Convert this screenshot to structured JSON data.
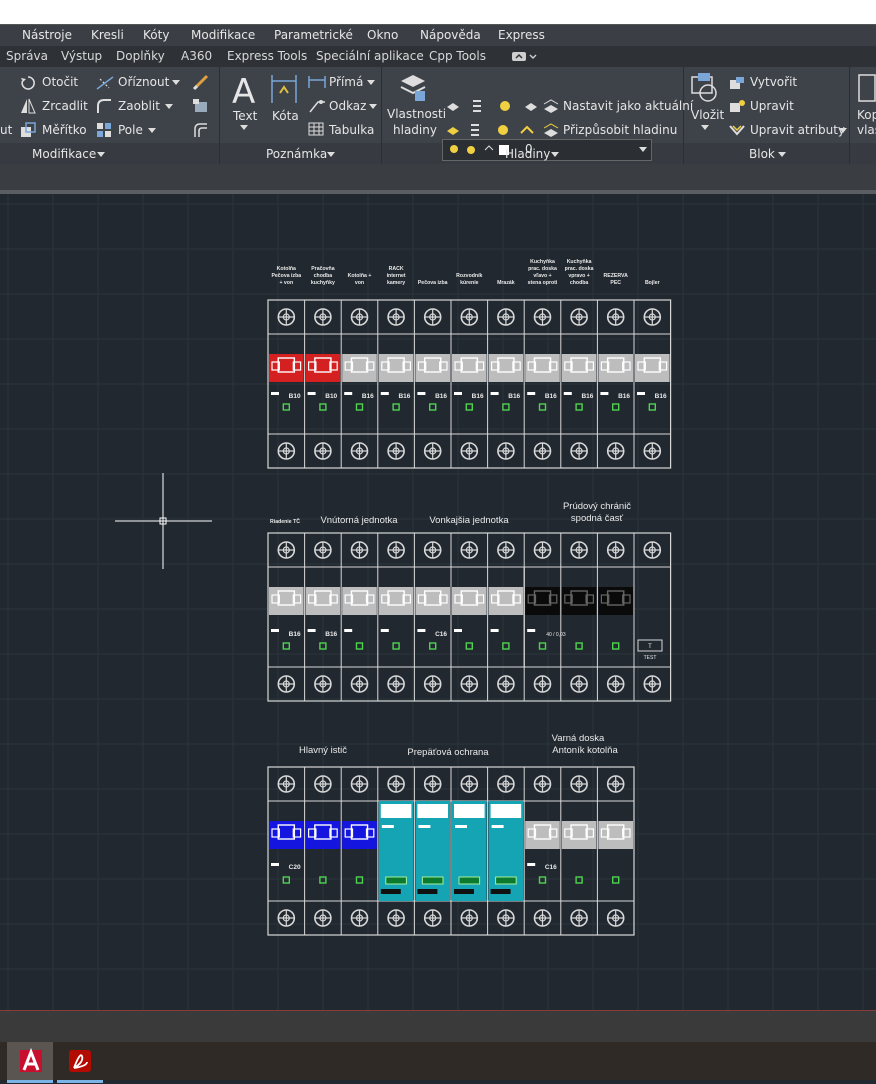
{
  "menu": [
    "Nástroje",
    "Kresli",
    "Kóty",
    "Modifikace",
    "Parametrické",
    "Okno",
    "Nápověda",
    "Express"
  ],
  "tabs": [
    "Správa",
    "Výstup",
    "Doplňky",
    "A360",
    "Express Tools",
    "Speciální aplikace",
    "Cpp Tools"
  ],
  "ribbon": {
    "modify": {
      "rotate": "Otočit",
      "trim": "Oříznout",
      "mirror": "Zrcadlit",
      "fillet": "Zaoblit",
      "scale": "Měřítko",
      "array": "Pole",
      "truncated": "ut",
      "panel": "Modifikace"
    },
    "annotation": {
      "text": "Text",
      "dimension": "Kóta",
      "linear": "Přímá",
      "leader": "Odkaz",
      "table": "Tabulka",
      "panel": "Poznámka"
    },
    "layers": {
      "properties_line1": "Vlastnosti",
      "properties_line2": "hladiny",
      "current_layer": "0",
      "make_current": "Nastavit jako aktuální",
      "match": "Přizpůsobit hladinu",
      "panel": "Hladiny"
    },
    "block": {
      "insert": "Vložit",
      "create": "Vytvořit",
      "edit": "Upravit",
      "edit_attributes": "Upravit atributy",
      "panel": "Blok"
    },
    "cut_right_1": "Kop",
    "cut_right_2": "vlas"
  },
  "drawing": {
    "row1": {
      "labels": [
        [
          "Kotolňa",
          "Pečova izba",
          "+ von"
        ],
        [
          "Pračovňa",
          "chodba",
          "kuchyňky"
        ],
        [
          "Kotolňa +",
          "von"
        ],
        [
          "RACK",
          "internet",
          "kamery"
        ],
        [
          "Pečova izba"
        ],
        [
          "Rozvodník",
          "kúrenie"
        ],
        [
          "Mrazák"
        ],
        [
          "Kuchyňka",
          "prac. doska",
          "vľavo +",
          "stena oproti"
        ],
        [
          "Kuchyňka",
          "prac. doska",
          "vpravo +",
          "chodba"
        ],
        [
          "REZERVA",
          "PEC"
        ],
        [
          "Bojler"
        ]
      ],
      "ratings": [
        "B10",
        "B10",
        "B16",
        "B16",
        "B16",
        "B16",
        "B16",
        "B16",
        "B16",
        "B16",
        "B16"
      ]
    },
    "row2": {
      "label_small": "Riadenie TČ",
      "label_inner": "Vnútorná jednotka",
      "label_outer": "Vonkajšia jednotka",
      "label_rcd_1": "Prúdový chránič",
      "label_rcd_2": "spodná časť",
      "ratings": [
        "B16",
        "B16",
        "",
        "",
        "C16",
        "",
        ""
      ],
      "rcd_rating": "40 / 0,03",
      "test_t": "T",
      "test_label": "TEST"
    },
    "row3": {
      "label_main": "Hlavný istič",
      "label_surge": "Prepäťová ochrana",
      "label_hob_1": "Varná doska",
      "label_hob_2": "Antoník kotolňa",
      "ratings": [
        "C20",
        "",
        "",
        "",
        "",
        "",
        "",
        "C16",
        "",
        ""
      ]
    }
  },
  "colors": {
    "red": "#d42020",
    "blue": "#1515e0",
    "teal": "#14a4b4",
    "black": "#0a0a0a",
    "grey": "#bdbdbd",
    "line": "#d8d8d8",
    "green": "#4fd44f"
  }
}
